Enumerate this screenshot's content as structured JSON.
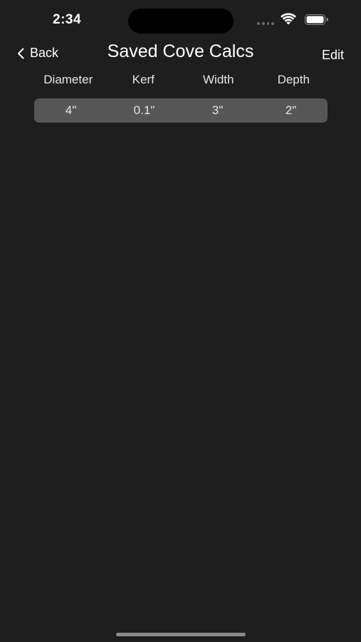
{
  "status_bar": {
    "time": "2:34"
  },
  "nav": {
    "back_label": "Back",
    "title": "Saved Cove Calcs",
    "edit_label": "Edit"
  },
  "table": {
    "headers": [
      "Diameter",
      "Kerf",
      "Width",
      "Depth"
    ],
    "rows": [
      [
        "4\"",
        "0.1\"",
        "3\"",
        "2\""
      ]
    ]
  },
  "colors": {
    "background": "#1e1e1e",
    "row_background": "#565656",
    "text": "#ffffff"
  },
  "icons": {
    "wifi": "wifi-icon",
    "battery": "battery-icon",
    "back": "chevron-left-icon"
  }
}
